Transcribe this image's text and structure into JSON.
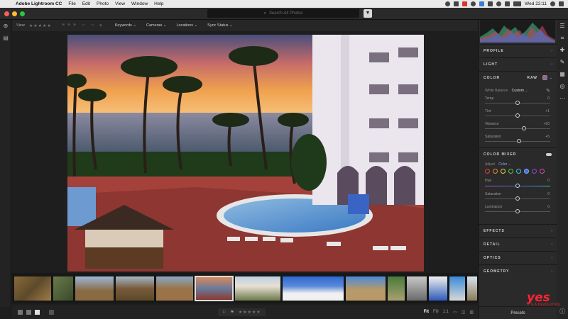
{
  "menubar": {
    "app_name": "Adobe Lightroom CC",
    "items": [
      "File",
      "Edit",
      "Photo",
      "View",
      "Window",
      "Help"
    ],
    "clock": "Wed 22:11"
  },
  "titlebar": {
    "search_placeholder": "Search All Photos"
  },
  "filterbar": {
    "view_label": "View",
    "stars": "★★★★★",
    "dropdowns": [
      "Keywords",
      "Cameras",
      "Locations",
      "Sync Status"
    ]
  },
  "right_panel": {
    "sections_top": [
      "PROFILE",
      "LIGHT"
    ],
    "color": {
      "title": "COLOR",
      "raw_label": "RAW",
      "white_balance_label": "White Balance",
      "white_balance_value": "Custom",
      "sliders": [
        {
          "label": "Temp",
          "value": "0",
          "position": 0.5
        },
        {
          "label": "Tint",
          "value": "+1",
          "position": 0.5
        },
        {
          "label": "Vibrance",
          "value": "+20",
          "position": 0.6
        },
        {
          "label": "Saturation",
          "value": "+5",
          "position": 0.52
        }
      ]
    },
    "color_mixer": {
      "title": "COLOR MIXER",
      "adjust_label": "Adjust",
      "adjust_value": "Color",
      "swatch_colors": [
        "#e04040",
        "#e68a2e",
        "#e6d23a",
        "#5ec24a",
        "#3ec7c7",
        "#3d6dd8",
        "#8a4ad8",
        "#d94ab6"
      ],
      "sliders": [
        {
          "label": "Hue",
          "value": "0",
          "position": 0.5
        },
        {
          "label": "Saturation",
          "value": "0",
          "position": 0.5
        },
        {
          "label": "Luminance",
          "value": "0",
          "position": 0.5
        }
      ]
    },
    "sections_bottom": [
      "EFFECTS",
      "DETAIL",
      "OPTICS",
      "GEOMETRY"
    ],
    "presets_label": "Presets"
  },
  "bottombar": {
    "stars": "★★★★★",
    "zoom_options": [
      "Fit",
      "Fill",
      "1:1"
    ]
  },
  "watermark": {
    "brand": "yes",
    "tagline": "IT'S A REVOLUTION"
  },
  "filmstrip": {
    "thumb_count": 14,
    "selected_index": 5
  },
  "colors": {
    "accent": "#8aa9ff",
    "panel_bg": "#2a2a2a",
    "watermark_red": "#ff2433"
  }
}
